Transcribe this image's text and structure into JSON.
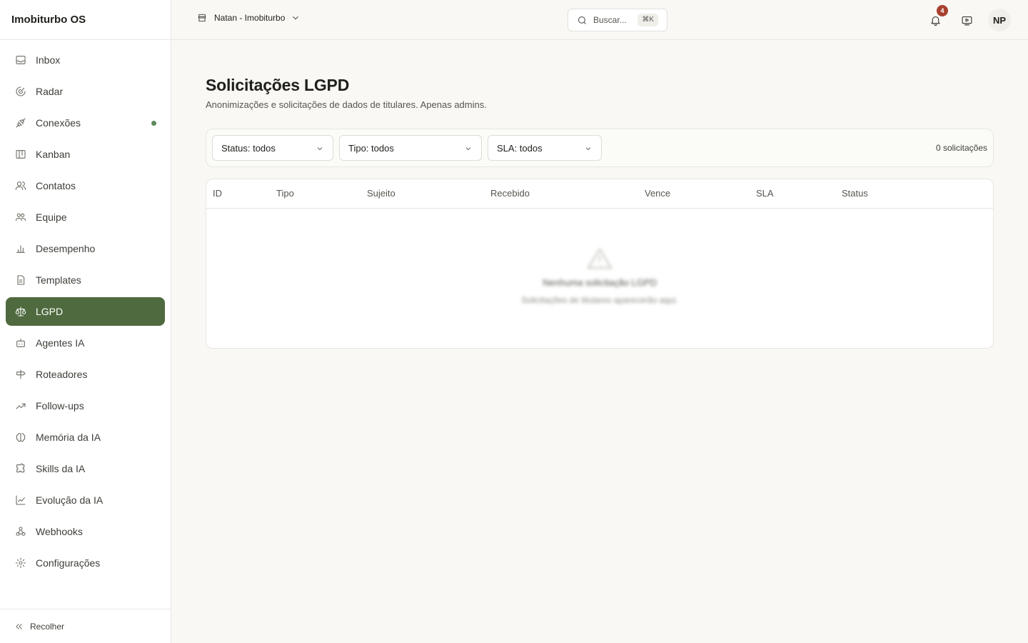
{
  "app": {
    "title": "Imobiturbo OS"
  },
  "sidebar": {
    "items": [
      {
        "label": "Inbox",
        "icon": "inbox-icon"
      },
      {
        "label": "Radar",
        "icon": "radar-icon"
      },
      {
        "label": "Conexões",
        "icon": "plug-icon",
        "status": "connected"
      },
      {
        "label": "Kanban",
        "icon": "kanban-icon"
      },
      {
        "label": "Contatos",
        "icon": "contacts-icon"
      },
      {
        "label": "Equipe",
        "icon": "team-icon"
      },
      {
        "label": "Desempenho",
        "icon": "bar-chart-icon"
      },
      {
        "label": "Templates",
        "icon": "file-text-icon"
      },
      {
        "label": "LGPD",
        "icon": "scale-icon",
        "active": true
      },
      {
        "label": "Agentes IA",
        "icon": "bot-icon"
      },
      {
        "label": "Roteadores",
        "icon": "signpost-icon"
      },
      {
        "label": "Follow-ups",
        "icon": "trend-arrow-icon"
      },
      {
        "label": "Memória da IA",
        "icon": "brain-icon"
      },
      {
        "label": "Skills da IA",
        "icon": "puzzle-icon"
      },
      {
        "label": "Evolução da IA",
        "icon": "line-chart-icon"
      },
      {
        "label": "Webhooks",
        "icon": "webhook-icon"
      },
      {
        "label": "Configurações",
        "icon": "gear-icon"
      }
    ],
    "collapse_label": "Recolher"
  },
  "topbar": {
    "workspace": "Natan - Imobiturbo",
    "search_placeholder": "Buscar...",
    "search_shortcut": "⌘K",
    "notifications_count": "4",
    "avatar_initials": "NP"
  },
  "page": {
    "title": "Solicitações LGPD",
    "subtitle": "Anonimizações e solicitações de dados de titulares. Apenas admins."
  },
  "filters": {
    "status": "Status: todos",
    "tipo": "Tipo: todos",
    "sla": "SLA: todos",
    "count": "0 solicitações"
  },
  "table": {
    "headers": [
      "ID",
      "Tipo",
      "Sujeito",
      "Recebido",
      "Vence",
      "SLA",
      "Status"
    ],
    "empty_title": "Nenhuma solicitação LGPD",
    "empty_desc": "Solicitações de titulares aparecerão aqui."
  },
  "colors": {
    "accent": "#4f6a3f",
    "badge": "#a8402f",
    "status_dot": "#5e8a5b",
    "background": "#f9f8f5"
  }
}
